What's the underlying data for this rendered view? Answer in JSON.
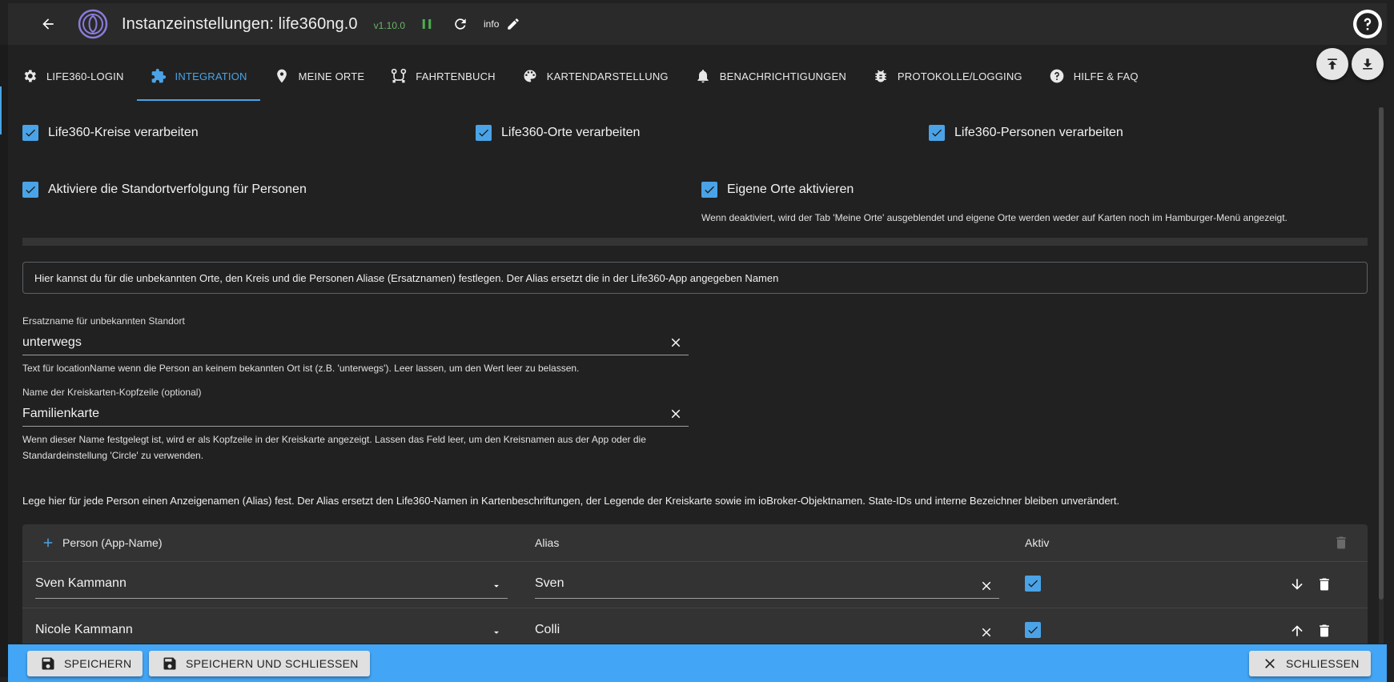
{
  "header": {
    "title": "Instanzeinstellungen: life360ng.0",
    "version": "v1.10.0",
    "info_label": "info"
  },
  "tabs": [
    {
      "label": "LIFE360-LOGIN",
      "icon": "gear-icon"
    },
    {
      "label": "INTEGRATION",
      "icon": "puzzle-icon",
      "active": true
    },
    {
      "label": "MEINE ORTE",
      "icon": "pin-icon"
    },
    {
      "label": "FAHRTENBUCH",
      "icon": "route-icon"
    },
    {
      "label": "KARTENDARSTELLUNG",
      "icon": "palette-icon"
    },
    {
      "label": "BENACHRICHTIGUNGEN",
      "icon": "bell-icon"
    },
    {
      "label": "PROTOKOLLE/LOGGING",
      "icon": "bug-icon"
    },
    {
      "label": "HILFE & FAQ",
      "icon": "help-icon"
    }
  ],
  "checkboxes": {
    "process_circles": {
      "label": "Life360-Kreise verarbeiten",
      "checked": true
    },
    "process_places": {
      "label": "Life360-Orte verarbeiten",
      "checked": true
    },
    "process_people": {
      "label": "Life360-Personen verarbeiten",
      "checked": true
    },
    "location_tracking": {
      "label": "Aktiviere die Standortverfolgung für Personen",
      "checked": true
    },
    "own_places": {
      "label": "Eigene Orte aktivieren",
      "checked": true
    }
  },
  "own_places_help": "Wenn deaktiviert, wird der Tab 'Meine Orte' ausgeblendet und eigene Orte werden weder auf Karten noch im Hamburger-Menü angezeigt.",
  "info_box": "Hier kannst du für die unbekannten Orte, den Kreis und die Personen Aliase (Ersatznamen) festlegen. Der Alias ersetzt die in der Life360-App angegeben Namen",
  "fields": {
    "unknown_location": {
      "label": "Ersatzname für unbekannten Standort",
      "value": "unterwegs",
      "help": "Text für locationName wenn die Person an keinem bekannten Ort ist (z.B. 'unterwegs'). Leer lassen, um den Wert leer zu belassen."
    },
    "circle_header": {
      "label": "Name der Kreiskarten-Kopfzeile (optional)",
      "value": "Familienkarte",
      "help_line1": "Wenn dieser Name festgelegt ist, wird er als Kopfzeile in der Kreiskarte angezeigt. Lassen das Feld leer, um den Kreisnamen aus der App oder die",
      "help_line2": "Standardeinstellung 'Circle' zu verwenden."
    }
  },
  "alias_paragraph": "Lege hier für jede Person einen Anzeigenamen (Alias) fest. Der Alias ersetzt den Life360-Namen in Kartenbeschriftungen, der Legende der Kreiskarte sowie im ioBroker-Objektnamen. State-IDs und interne Bezeichner bleiben unverändert.",
  "table": {
    "headers": {
      "person": "Person (App-Name)",
      "alias": "Alias",
      "active": "Aktiv"
    },
    "rows": [
      {
        "person": "Sven Kammann",
        "alias": "Sven",
        "active": true,
        "move": "down"
      },
      {
        "person": "Nicole Kammann",
        "alias": "Colli",
        "active": true,
        "move": "up"
      }
    ]
  },
  "footer": {
    "save": "SPEICHERN",
    "save_close": "SPEICHERN UND SCHLIESSEN",
    "close": "SCHLIESSEN"
  },
  "colors": {
    "accent": "#4aa3e6",
    "footer": "#42a5f5",
    "version": "#6bb36b"
  }
}
